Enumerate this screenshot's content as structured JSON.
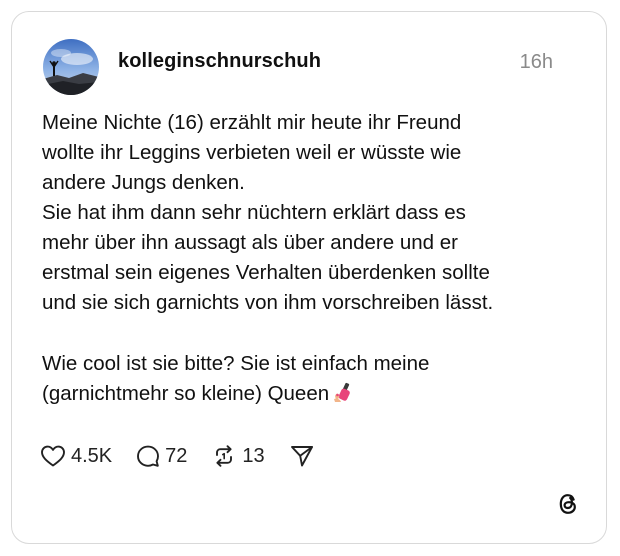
{
  "post": {
    "username": "kolleginschnurschuh",
    "time": "16h",
    "lines": [
      "Meine Nichte (16) erzählt mir heute ihr Freund",
      "wollte ihr Leggins verbieten weil er wüsste wie",
      "andere Jungs denken.",
      "Sie hat ihm dann sehr nüchtern erklärt dass es",
      "mehr über ihn aussagt als über andere und er",
      "erstmal sein eigenes Verhalten überdenken sollte",
      "und sie sich garnichts von ihm vorschreiben lässt.",
      "Wie cool ist sie bitte? Sie ist einfach meine",
      "(garnichtmehr so kleine) Queen"
    ],
    "emoji_name": "nail-polish-emoji"
  },
  "actions": {
    "likes": "4.5K",
    "replies": "72",
    "reposts": "13"
  },
  "icons": {
    "like": "heart-icon",
    "reply": "speech-bubble-icon",
    "repost": "repost-icon",
    "share": "send-icon",
    "brand": "threads-logo-icon"
  },
  "colors": {
    "text": "#101010",
    "muted": "#8a8a8a",
    "border": "#d9d9d9",
    "emoji_polish": "#e8457a"
  }
}
